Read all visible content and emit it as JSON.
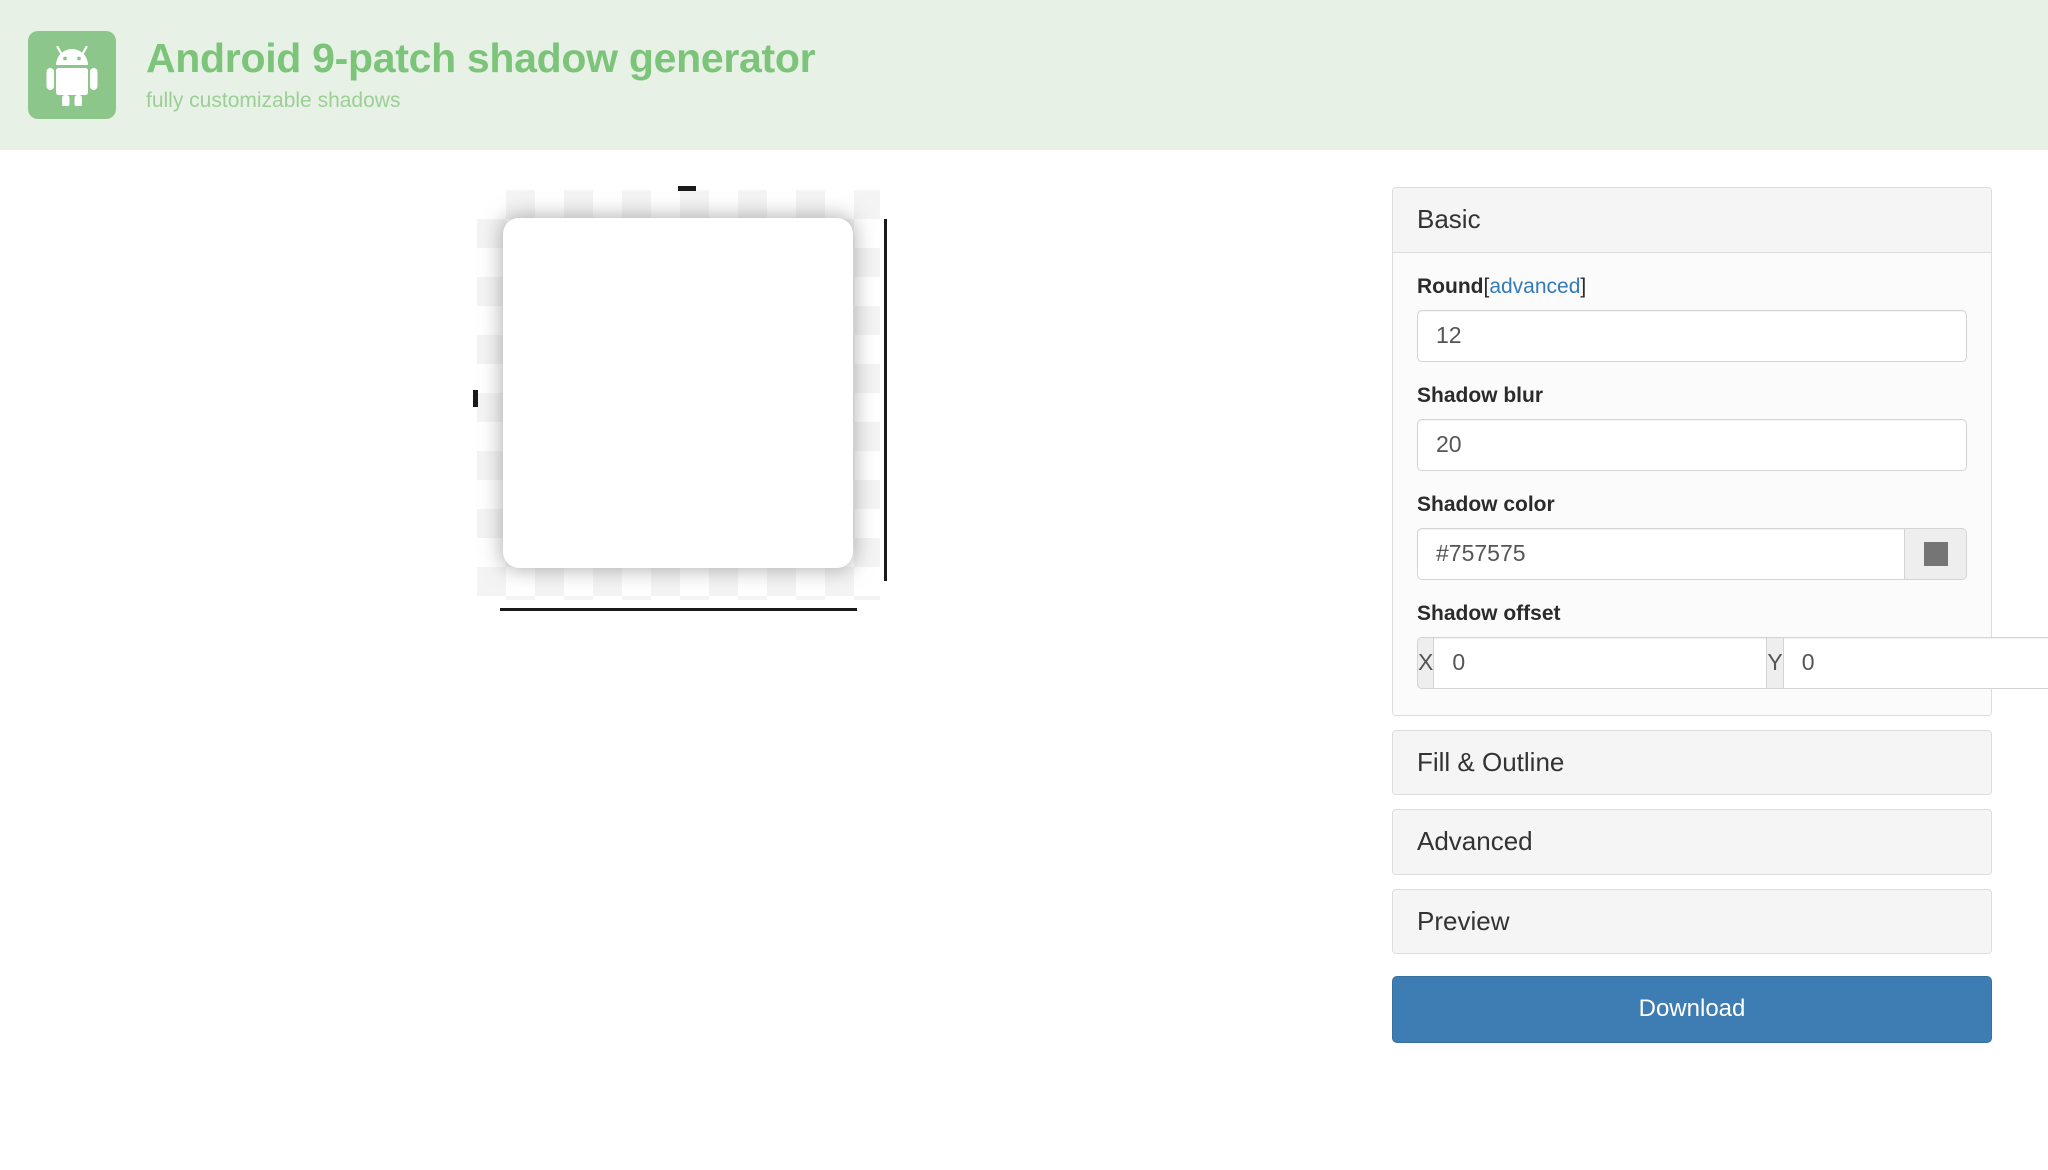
{
  "header": {
    "logo_icon": "android-robot-icon",
    "title": "Android 9-patch shadow generator",
    "subtitle": "fully customizable shadows",
    "bg_color": "#e7f1e6",
    "title_color": "#7cc47a",
    "logo_bg_color": "#8dc68a"
  },
  "preview": {
    "name": "nine-patch-preview-canvas",
    "shape": "rounded-rectangle",
    "checkerboard": "transparency-checkerboard",
    "marks": {
      "top": "stretch-mark-top",
      "left": "stretch-mark-left",
      "right": "content-mark-right",
      "bottom": "content-mark-bottom"
    }
  },
  "sidebar": {
    "panels": [
      {
        "id": "basic",
        "title": "Basic",
        "expanded": true,
        "fields": [
          {
            "id": "round",
            "label": "Round",
            "link_open_bracket": "[",
            "link_label": "advanced",
            "link_close_bracket": "]",
            "value": "12",
            "placeholder": "Round"
          },
          {
            "id": "shadow-blur",
            "label": "Shadow blur",
            "value": "20",
            "placeholder": "Shadow blur"
          },
          {
            "id": "shadow-color",
            "label": "Shadow color",
            "value": "#757575",
            "placeholder": "#757575",
            "swatch_color": "#757575"
          },
          {
            "id": "shadow-offset",
            "label": "Shadow offset",
            "x_addon": "X",
            "x_value": "0",
            "x_placeholder": "0",
            "y_addon": "Y",
            "y_value": "0",
            "y_placeholder": "0"
          }
        ]
      },
      {
        "id": "fill-outline",
        "title": "Fill & Outline",
        "expanded": false
      },
      {
        "id": "advanced",
        "title": "Advanced",
        "expanded": false
      },
      {
        "id": "preview",
        "title": "Preview",
        "expanded": false
      }
    ],
    "download_label": "Download",
    "download_color": "#3d7db3"
  }
}
